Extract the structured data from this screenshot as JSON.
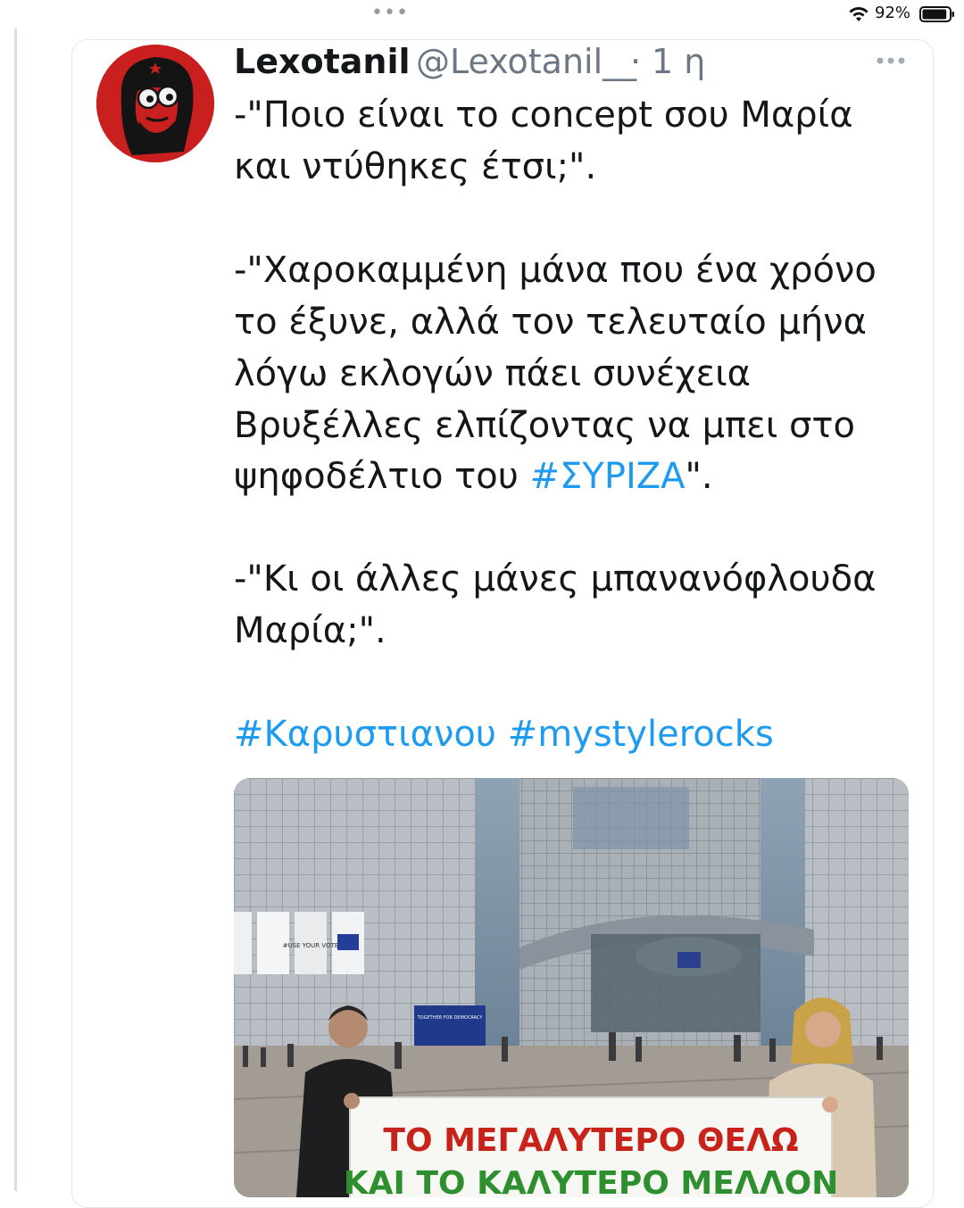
{
  "status_bar": {
    "battery_percent": "92%",
    "battery_level": 0.92,
    "icons": [
      "wifi-icon",
      "battery-icon"
    ]
  },
  "tweet": {
    "display_name": "Lexotanil",
    "handle": "@Lexotanil__",
    "separator": "·",
    "time": "1 η",
    "avatar_icon": "cartoon-avatar-icon",
    "lines": {
      "l1": "-\"Ποιο είναι το concept σου Μαρία",
      "l2": "και ντύθηκες έτσι;\".",
      "l3": "-\"Χαροκαμμένη μάνα που ένα χρόνο",
      "l4": "το έξυνε, αλλά τον τελευταίο μήνα",
      "l5": "λόγω εκλογών πάει συνέχεια",
      "l6": "Βρυξέλλες ελπίζοντας να μπει στο",
      "l7_pre": "ψηφοδέλτιο του ",
      "l7_tag": "#ΣΥΡΙΖΑ",
      "l7_post": "\".",
      "l8": "-\"Κι οι άλλες μάνες μπανανόφλουδα",
      "l9": "Μαρία;\"."
    },
    "hashtags": [
      "#Καρυστιανου",
      "#mystylerocks"
    ],
    "link_color": "#1d9bf0"
  },
  "media": {
    "banner_line1": "ΤΟ ΜΕΓΑΛΥΤΕΡΟ ΘΕΛΩ",
    "banner_line2": "ΚΑΙ ΤΟ ΚΑΛΥΤΕΡΟ ΜΕΛΛΟΝ",
    "sign_text_1": "#USE YOUR VOTE",
    "sign_text_2": "TOGETHER FOR DEMOCRACY"
  }
}
